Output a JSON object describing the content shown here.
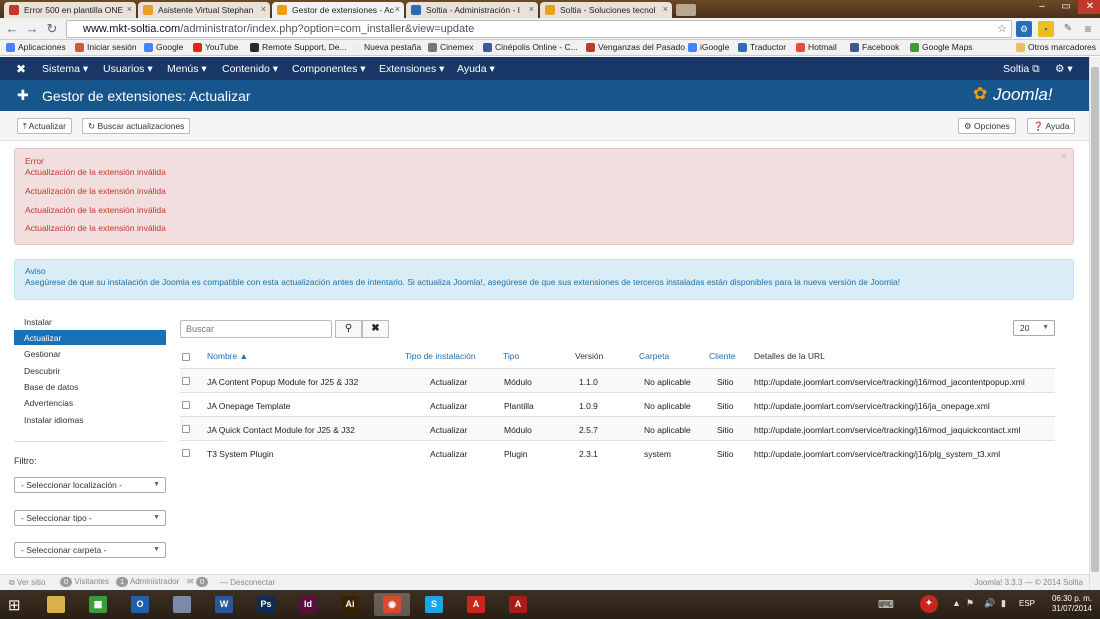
{
  "browser": {
    "tabs": [
      {
        "label": "Error 500 en plantilla ONE",
        "color": "#c0392b"
      },
      {
        "label": "Asistente Virtual Stephan",
        "color": "#e8a020"
      },
      {
        "label": "Gestor de extensiones - Ac",
        "color": "#f39c12"
      },
      {
        "label": "Soltia - Administración - I",
        "color": "#2a6db5"
      },
      {
        "label": "Soltia - Soluciones tecnol",
        "color": "#e8a020"
      }
    ],
    "url_prefix": "www.mkt-soltia.com",
    "url_rest": "/administrator/index.php?option=com_installer&view=update",
    "bookmarks": [
      "Aplicaciones",
      "Iniciar sesión",
      "Google",
      "YouTube",
      "Remote Support, De...",
      "Nueva pestaña",
      "Cinemex",
      "Cinépolis Online - C...",
      "Venganzas del Pasado",
      "iGoogle",
      "Traductor",
      "Hotmail",
      "Facebook",
      "Google Maps"
    ],
    "bookmarks_other": "Otros marcadores"
  },
  "joomla": {
    "menu": [
      "Sistema ▾",
      "Usuarios ▾",
      "Menús ▾",
      "Contenido ▾",
      "Componentes ▾",
      "Extensiones ▾",
      "Ayuda ▾"
    ],
    "site_link": "Soltia ⧉",
    "title": "Gestor de extensiones: Actualizar",
    "logo_text": "Joomla!",
    "toolbar": {
      "update": "Actualizar",
      "find": "Buscar actualizaciones",
      "options": "Opciones",
      "help": "Ayuda"
    },
    "error": {
      "heading": "Error",
      "messages": [
        "Actualización de la extensión inválida",
        "Actualización de la extensión inválida",
        "Actualización de la extensión inválida",
        "Actualización de la extensión inválida"
      ]
    },
    "notice": {
      "heading": "Aviso",
      "text": "Asegúrese de que su instalación de Joomla es compatible con esta actualización antes de intentarlo. Si actualiza Joomla!, asegúrese de que sus extensiones de terceros instaladas están disponibles para la nueva versión de Joomla!"
    },
    "sidebar": [
      "Instalar",
      "Actualizar",
      "Gestionar",
      "Descubrir",
      "Base de datos",
      "Advertencias",
      "Instalar idiomas"
    ],
    "filter_label": "Filtro:",
    "filters": [
      "- Seleccionar localización -",
      "- Seleccionar tipo -",
      "- Seleccionar carpeta -"
    ],
    "search_placeholder": "Buscar",
    "limit": "20",
    "table": {
      "headers": [
        "Nombre ▲",
        "Tipo de instalación",
        "Tipo",
        "Versión",
        "Carpeta",
        "Cliente",
        "Detalles de la URL"
      ],
      "rows": [
        [
          "JA Content Popup Module for J25 & J32",
          "Actualizar",
          "Módulo",
          "1.1.0",
          "No aplicable",
          "Sitio",
          "http://update.joomlart.com/service/tracking/j16/mod_jacontentpopup.xml"
        ],
        [
          "JA Onepage Template",
          "Actualizar",
          "Plantilla",
          "1.0.9",
          "No aplicable",
          "Sitio",
          "http://update.joomlart.com/service/tracking/j16/ja_onepage.xml"
        ],
        [
          "JA Quick Contact Module for J25 & J32",
          "Actualizar",
          "Módulo",
          "2.5.7",
          "No aplicable",
          "Sitio",
          "http://update.joomlart.com/service/tracking/j16/mod_jaquickcontact.xml"
        ],
        [
          "T3 System Plugin",
          "Actualizar",
          "Plugin",
          "2.3.1",
          "system",
          "Sitio",
          "http://update.joomlart.com/service/tracking/j16/plg_system_t3.xml"
        ]
      ]
    },
    "status": {
      "view_site": "Ver sitio",
      "visitors_count": "0",
      "visitors": "Visitantes",
      "admins_count": "1",
      "admins": "Administrador",
      "msg_count": "0",
      "logout": "Desconectar",
      "version": "Joomla! 3.3.3 — © 2014 Soltia"
    }
  },
  "taskbar": {
    "apps": [
      {
        "icon": "folder-icon",
        "color": "#d9b24c",
        "glyph": ""
      },
      {
        "icon": "apps-grid-icon",
        "color": "#3a9d3a",
        "glyph": "▦"
      },
      {
        "icon": "outlook-icon",
        "color": "#1f5fb0",
        "glyph": "O"
      },
      {
        "icon": "tools-icon",
        "color": "#7a8aa8",
        "glyph": ""
      },
      {
        "icon": "word-icon",
        "color": "#2b579a",
        "glyph": "W"
      },
      {
        "icon": "photoshop-icon",
        "color": "#0e2d52",
        "glyph": "Ps"
      },
      {
        "icon": "indesign-icon",
        "color": "#5a0f3a",
        "glyph": "Id"
      },
      {
        "icon": "illustrator-icon",
        "color": "#3a2200",
        "glyph": "Ai"
      },
      {
        "icon": "chrome-icon",
        "color": "#d94a30",
        "glyph": "◉"
      },
      {
        "icon": "skype-icon",
        "color": "#1aa5e6",
        "glyph": "S"
      },
      {
        "icon": "acrobat-icon",
        "color": "#c9261d",
        "glyph": "A"
      },
      {
        "icon": "acrobat-reader-icon",
        "color": "#a81b16",
        "glyph": "A"
      }
    ],
    "lang": "ESP",
    "time": "06:30 p. m.",
    "date": "31/07/2014"
  }
}
